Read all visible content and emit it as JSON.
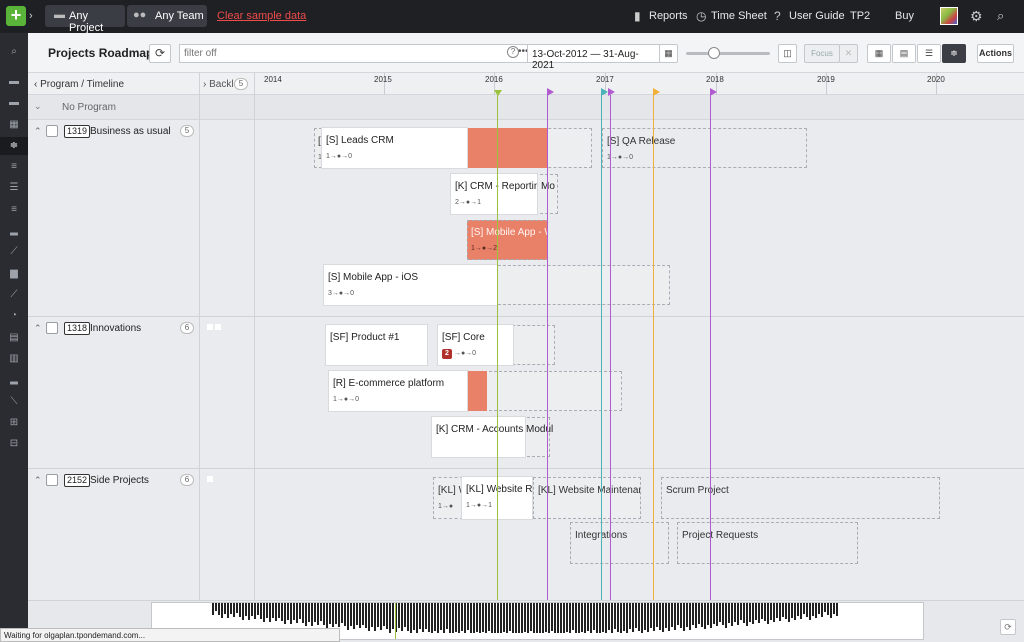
{
  "topbar": {
    "project_label": "Any Project",
    "team_label": "Any Team",
    "clear_label": "Clear sample data",
    "reports_label": "Reports",
    "timesheet_label": "Time Sheet",
    "userguide_label": "User Guide",
    "tp2_label": "TP2",
    "buy_label": "Buy"
  },
  "toolbar": {
    "title": "Projects Roadmap",
    "filter_placeholder": "filter off",
    "date_range": "13-Oct-2012 — 31-Aug-2021",
    "zoom_level": 0.33,
    "focus_label": "Focus",
    "actions_label": "Actions"
  },
  "header": {
    "program_timeline_label": "Program / Timeline",
    "backlog_label": "Backlo",
    "backlog_count": "5",
    "years": [
      "2014",
      "2015",
      "2016",
      "2017",
      "2018",
      "2019",
      "2020"
    ]
  },
  "no_program_label": "No Program",
  "lanes": [
    {
      "id": "1319",
      "name": "Business as usual",
      "count": "5"
    },
    {
      "id": "1318",
      "name": "Innovations",
      "count": "6"
    },
    {
      "id": "2152",
      "name": "Side Projects",
      "count": "6"
    }
  ],
  "cards": {
    "leads_crm": {
      "name": "[S] Leads CRM",
      "flow": "1→●→0",
      "lead": "[",
      "lead_flow": "1"
    },
    "qa_release": {
      "name": "[S] QA Release",
      "flow": "1→●→0"
    },
    "crm_reporting": {
      "name": "[K] CRM - Reporting",
      "flow": "2→●→1",
      "ext": "Mo"
    },
    "mobile_app_w": {
      "name": "[S] Mobile App - W",
      "flow": "1→●→2"
    },
    "mobile_app_ios": {
      "name": "[S] Mobile App - iOS",
      "flow": "3→●→0"
    },
    "product1": {
      "name": "[SF] Product #1"
    },
    "core": {
      "name": "[SF] Core",
      "badge": "2",
      "flow": "→●→0"
    },
    "ecommerce": {
      "name": "[R] E-commerce platform",
      "flow": "1→●→0"
    },
    "crm_accounts": {
      "name": "[K] CRM - Accounts Modul"
    },
    "kl_w": {
      "name": "[KL] W",
      "flow": "1→●"
    },
    "kl_website_re": {
      "name": "[KL] Website Re",
      "flow": "1→●→1"
    },
    "kl_website_maint": {
      "name": "[KL] Website Maintenar"
    },
    "scrum": {
      "name": "Scrum Project"
    },
    "integrations": {
      "name": "Integrations"
    },
    "project_requests": {
      "name": "Project Requests"
    }
  },
  "status_text": "Waiting for olgaplan.tpondemand.com...",
  "colors": {
    "accent_red": "#e98068",
    "today_line": "#9bc23c",
    "milestone_purple": "#b15bd0",
    "milestone_teal": "#4bb3b8",
    "milestone_orange": "#f0b03a"
  }
}
